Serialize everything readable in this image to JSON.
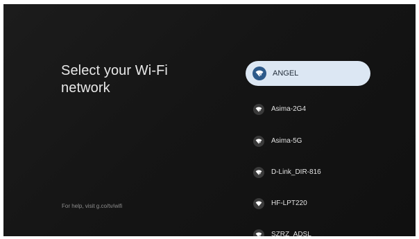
{
  "screen": {
    "title": "Select your Wi-Fi network",
    "help": "For help, visit g.co/tv/wifi"
  },
  "networks": [
    {
      "name": "ANGEL",
      "selected": true,
      "icon": "wifi-lock-icon"
    },
    {
      "name": "Asima-2G4",
      "selected": false,
      "icon": "wifi-lock-icon"
    },
    {
      "name": "Asima-5G",
      "selected": false,
      "icon": "wifi-lock-icon"
    },
    {
      "name": "D-Link_DIR-816",
      "selected": false,
      "icon": "wifi-lock-icon"
    },
    {
      "name": "HF-LPT220",
      "selected": false,
      "icon": "wifi-icon"
    },
    {
      "name": "SZRZ_ADSL",
      "selected": false,
      "icon": "wifi-lock-icon"
    }
  ],
  "colors": {
    "background": "#151515",
    "selected_bg": "#dce7f3",
    "selected_icon_bg": "#2d5a8a",
    "text": "#e2e2e2"
  }
}
